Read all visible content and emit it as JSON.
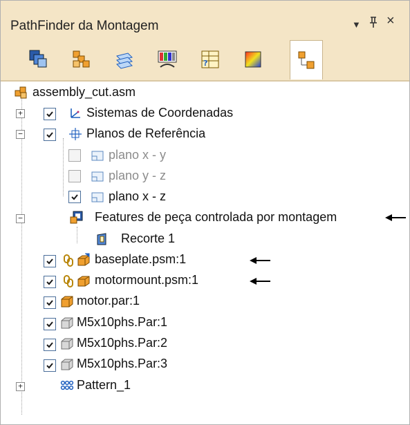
{
  "panel": {
    "title": "PathFinder da Montagem",
    "menu_glyph": "▼",
    "pin_glyph": "ᵻ",
    "close_glyph": "×"
  },
  "tabs": [
    {
      "icon": "assembly-parts-icon",
      "active": false
    },
    {
      "icon": "layers-icon",
      "active": false
    },
    {
      "icon": "sheets-icon",
      "active": false
    },
    {
      "icon": "display-configurations-icon",
      "active": false
    },
    {
      "icon": "variable-table-icon",
      "active": false
    },
    {
      "icon": "render-icon",
      "active": false
    },
    {
      "icon": "tree-structure-icon",
      "active": true
    }
  ],
  "tree": {
    "root": "assembly_cut.asm",
    "coordinate_systems": "Sistemas de Coordenadas",
    "reference_planes": "Planos de Referência",
    "plane_xy": "plano x - y",
    "plane_yz": "plano y - z",
    "plane_xz": "plano x - z",
    "assembly_features": "Features de peça controlada por montagem",
    "cut": "Recorte 1",
    "baseplate": "baseplate.psm:1",
    "motormount": "motormount.psm:1",
    "motor": "motor.par:1",
    "m5_1": "M5x10phs.Par:1",
    "m5_2": "M5x10phs.Par:2",
    "m5_3": "M5x10phs.Par:3",
    "pattern": "Pattern_1"
  },
  "colors": {
    "titlebar": "#f4e5c6",
    "accent_blue": "#1f5fbf",
    "part_orange": "#e08a1e"
  }
}
